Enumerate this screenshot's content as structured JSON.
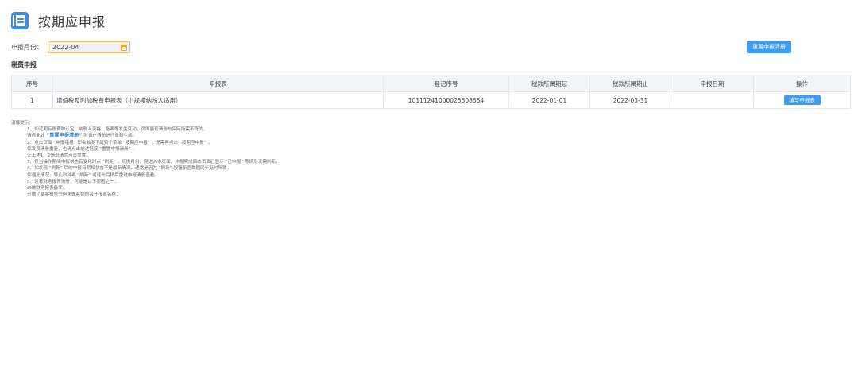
{
  "header": {
    "title": "按期应申报",
    "logo_icon": "notebook-icon"
  },
  "filter": {
    "month_label": "申报月份：",
    "month_value": "2022-04",
    "calendar_icon": "calendar-icon"
  },
  "actions": {
    "reset_label": "重置申报清册"
  },
  "section": {
    "label": "税费申报"
  },
  "table": {
    "headers": [
      "序号",
      "申报表",
      "登记序号",
      "税款所属期起",
      "税款所属期止",
      "申报日期",
      "操作"
    ],
    "rows": [
      {
        "index": "1",
        "form": "增值税及附加税费申报表（小规模纳税人适用）",
        "reg_no": "10111241000025508564",
        "period_start": "2022-01-01",
        "period_end": "2022-03-31",
        "declare_date": "",
        "action": "填写申报表"
      }
    ]
  },
  "notes": {
    "title": "温馨提示：",
    "l1": "1、如近期有税费种认定、纳税人资格、备案等发生变动，页面展现清册与实际所需不符的，",
    "l2a": "请点此处",
    "l2b": "“重置申报清册”",
    "l2c": "对该户清册进行重新生成。",
    "l3": "2、点击页面 “申报错报” 即会触发下属资个菜单 “按期应申报” ，无需再点击 “按期应申报” ，",
    "l4": "如发现清册重复，也请点击前述链接 “重置申报清册” 。",
    "l5": "无上述1、2情况请勿点击重置。",
    "l6": "3、仅当操作期间申报状态有变化时点 “刷新” ，切换月份、刚进入本页面、申报完成后本页面已显示 “已申报” 等情形无需刷新。",
    "l7": "4、如发现 “刷新” 后的申报日期和状态不是最新情况，通常是因为 “刷新” 按钮所查数据同步延时所致，",
    "l8": "如遇此情况，等几秒钟再 “刷新” 或退出后稍后重进申报清册查看。",
    "l9": "5、没有财务报表清册，可能是以下原因之一：",
    "l10": "未做财务报表备案；",
    "l11": "只做了备案报告书但未做具体的会计报表名称；"
  },
  "colors": {
    "accent": "#3d9bf2",
    "input_border": "#f0c060"
  }
}
